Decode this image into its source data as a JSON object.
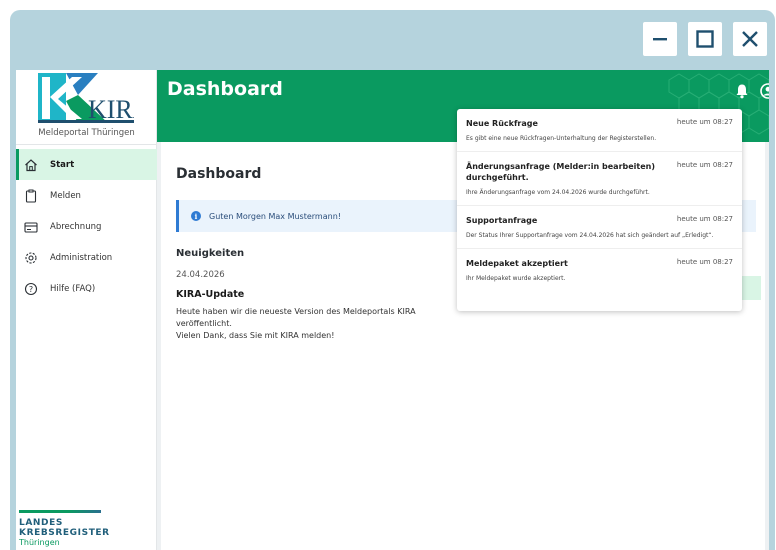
{
  "window": {
    "controls": {
      "minimize": "minimize-icon",
      "maximize": "maximize-icon",
      "close": "close-icon"
    }
  },
  "colors": {
    "brand_green": "#0a9a60",
    "window_frame": "#b5d3dd",
    "info_blue": "#2f7bd3",
    "active_nav_bg": "#d9f5e5"
  },
  "sidebar": {
    "logo_text": "KIRA",
    "logo_subtitle": "Meldeportal Thüringen",
    "items": [
      {
        "label": "Start",
        "icon": "home-icon",
        "active": true
      },
      {
        "label": "Melden",
        "icon": "clipboard-icon",
        "active": false
      },
      {
        "label": "Abrechnung",
        "icon": "card-icon",
        "active": false
      },
      {
        "label": "Administration",
        "icon": "gear-icon",
        "active": false
      },
      {
        "label": "Hilfe (FAQ)",
        "icon": "help-icon",
        "active": false
      }
    ],
    "footer_logo": {
      "line1": "LANDES",
      "line2": "KREBSREGISTER",
      "line3": "Thüringen"
    }
  },
  "header": {
    "title": "Dashboard",
    "icons": [
      "bell-icon",
      "user-icon"
    ]
  },
  "main": {
    "title": "Dashboard",
    "greeting": "Guten Morgen Max Mustermann!",
    "news_heading": "Neuigkeiten",
    "news": {
      "date": "24.04.2026",
      "title": "KIRA-Update",
      "body1": "Heute haben wir die neueste Version des Meldeportals KIRA veröffentlicht.",
      "body2": "Vielen Dank, dass Sie mit KIRA melden!"
    }
  },
  "notifications": [
    {
      "title": "Neue Rückfrage",
      "time": "heute um 08:27",
      "body": "Es gibt eine neue Rückfragen-Unterhaltung der Registerstellen."
    },
    {
      "title": "Änderungsanfrage (Melder:in bearbeiten) durchgeführt.",
      "time": "heute um 08:27",
      "body": "Ihre Änderungsanfrage vom 24.04.2026 wurde durchgeführt."
    },
    {
      "title": "Supportanfrage",
      "time": "heute um 08:27",
      "body": "Der Status Ihrer Supportanfrage vom 24.04.2026 hat sich geändert auf „Erledigt“."
    },
    {
      "title": "Meldepaket akzeptiert",
      "time": "heute um 08:27",
      "body": "Ihr Meldepaket wurde akzeptiert."
    }
  ]
}
